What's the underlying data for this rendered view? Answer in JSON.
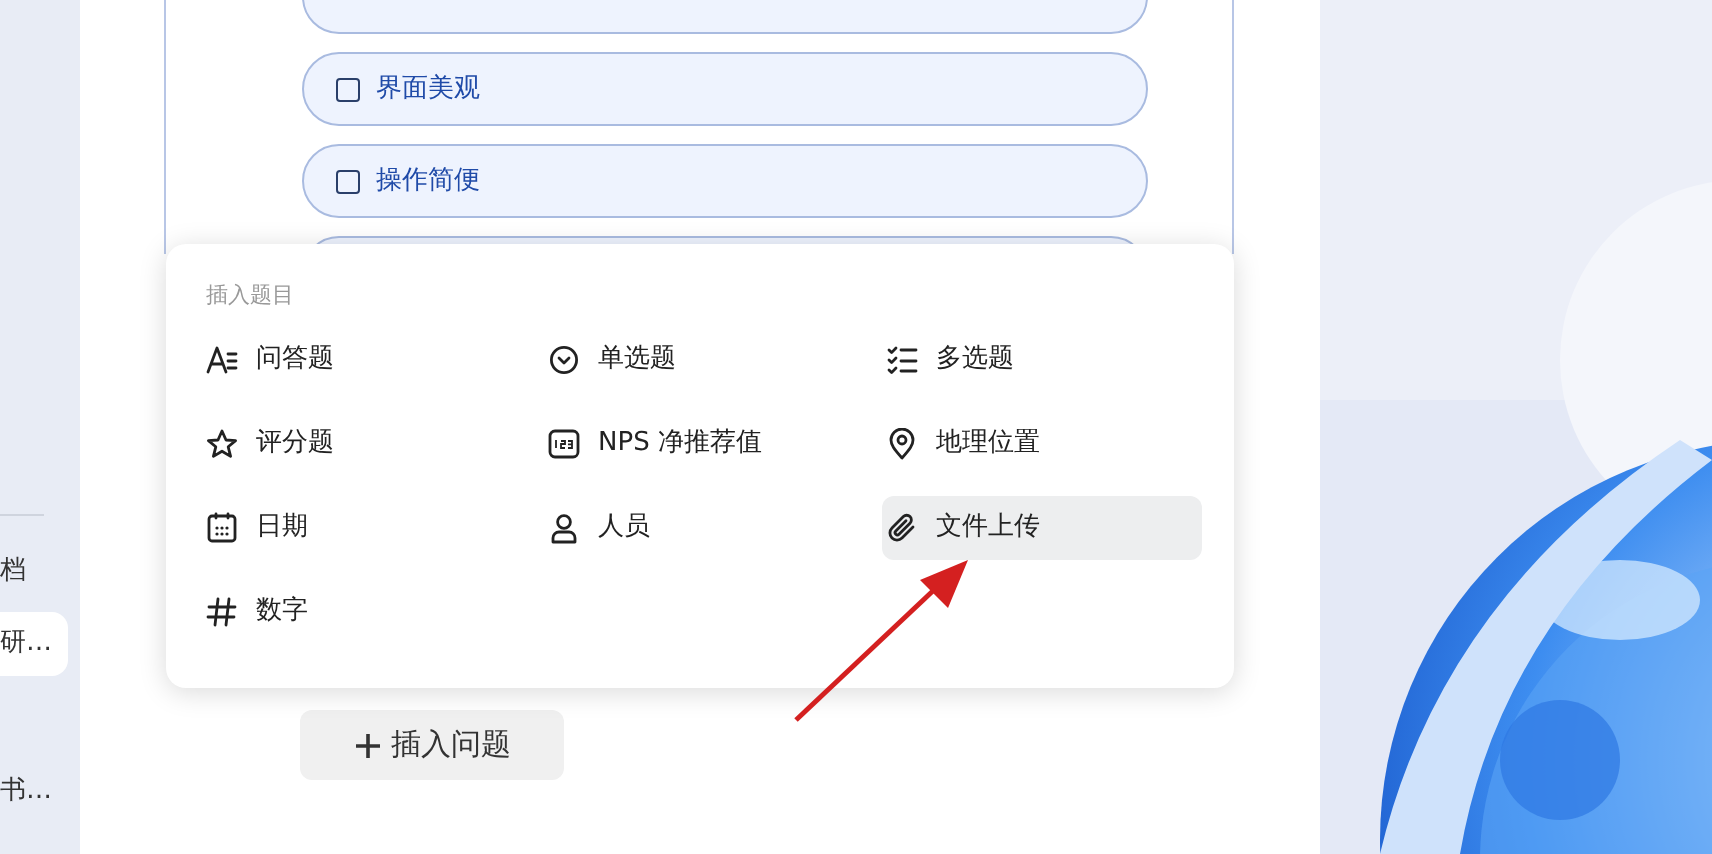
{
  "sidebar": {
    "items": [
      {
        "label": "档",
        "selected": false
      },
      {
        "label": "研…",
        "selected": true
      },
      {
        "label": "书…",
        "selected": false
      }
    ]
  },
  "options": [
    {
      "label": "界面美观",
      "checked": false
    },
    {
      "label": "操作简便",
      "checked": false
    }
  ],
  "insert_menu": {
    "title": "插入题目",
    "items": [
      {
        "label": "问答题",
        "kind": "text",
        "selected": false
      },
      {
        "label": "单选题",
        "kind": "radio",
        "selected": false
      },
      {
        "label": "多选题",
        "kind": "checklist",
        "selected": false
      },
      {
        "label": "评分题",
        "kind": "star",
        "selected": false
      },
      {
        "label": "NPS 净推荐值",
        "kind": "nps",
        "selected": false
      },
      {
        "label": "地理位置",
        "kind": "pin",
        "selected": false
      },
      {
        "label": "日期",
        "kind": "calendar",
        "selected": false
      },
      {
        "label": "人员",
        "kind": "person",
        "selected": false
      },
      {
        "label": "文件上传",
        "kind": "clip",
        "selected": true
      },
      {
        "label": "数字",
        "kind": "hash",
        "selected": false
      }
    ]
  },
  "insert_button": {
    "label": "插入问题"
  }
}
